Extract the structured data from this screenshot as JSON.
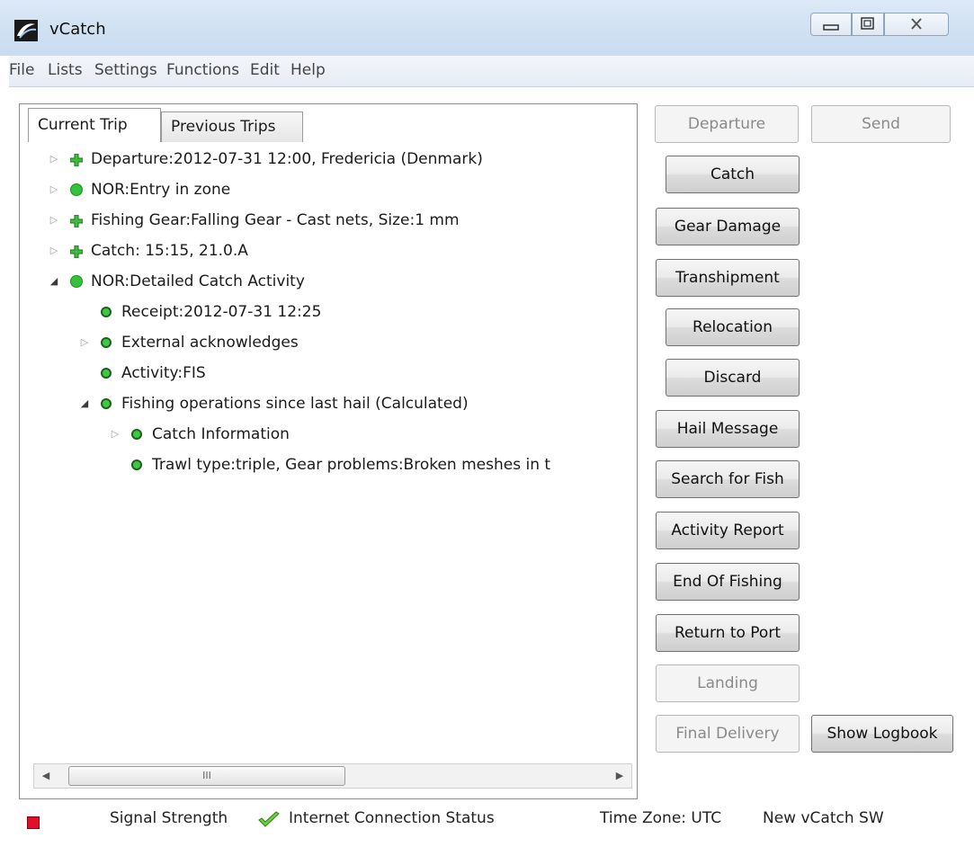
{
  "window": {
    "title": "vCatch"
  },
  "menu": [
    "File",
    "Lists",
    "Settings",
    "Functions",
    "Edit",
    "Help"
  ],
  "tabs": {
    "current": "Current Trip",
    "previous": "Previous Trips"
  },
  "tree": [
    {
      "text": "Departure:2012-07-31 12:00,  Fredericia (Denmark)",
      "icon": "plus-icon",
      "expander": "collapsed"
    },
    {
      "text": "NOR:Entry in zone",
      "icon": "green-dot-icon",
      "expander": "collapsed"
    },
    {
      "text": "Fishing Gear:Falling Gear - Cast nets, Size:1 mm",
      "icon": "plus-icon",
      "expander": "collapsed"
    },
    {
      "text": "Catch: 15:15, 21.0.A",
      "icon": "plus-icon",
      "expander": "collapsed"
    },
    {
      "text": "NOR:Detailed Catch Activity",
      "icon": "green-dot-icon",
      "expander": "expanded"
    },
    {
      "text": "Receipt:2012-07-31 12:25",
      "icon": "small-dot-icon",
      "expander": "none"
    },
    {
      "text": "External acknowledges",
      "icon": "small-dot-icon",
      "expander": "collapsed"
    },
    {
      "text": "Activity:FIS",
      "icon": "small-dot-icon",
      "expander": "none"
    },
    {
      "text": "Fishing operations since last hail (Calculated)",
      "icon": "small-dot-icon",
      "expander": "expanded"
    },
    {
      "text": "Catch Information",
      "icon": "small-dot-icon",
      "expander": "collapsed"
    },
    {
      "text": "Trawl type:triple, Gear problems:Broken meshes in t",
      "icon": "small-dot-icon",
      "expander": "none"
    }
  ],
  "scrollbar": {
    "grip": "III"
  },
  "buttons": {
    "departure": "Departure",
    "send": "Send",
    "catch": "Catch",
    "gear_damage": "Gear Damage",
    "transhipment": "Transhipment",
    "relocation": "Relocation",
    "discard": "Discard",
    "hail_message": "Hail Message",
    "search_for_fish": "Search for Fish",
    "activity_report": "Activity Report",
    "end_of_fishing": "End Of Fishing",
    "return_to_port": "Return to Port",
    "landing": "Landing",
    "final_delivery": "Final Delivery",
    "show_logbook": "Show Logbook"
  },
  "status": {
    "signal": "Signal Strength",
    "internet": "Internet Connection Status",
    "timezone": "Time Zone: UTC",
    "version": "New vCatch SW"
  },
  "colors": {
    "signal_indicator": "#e0102a",
    "node_green": "#35c23a"
  }
}
